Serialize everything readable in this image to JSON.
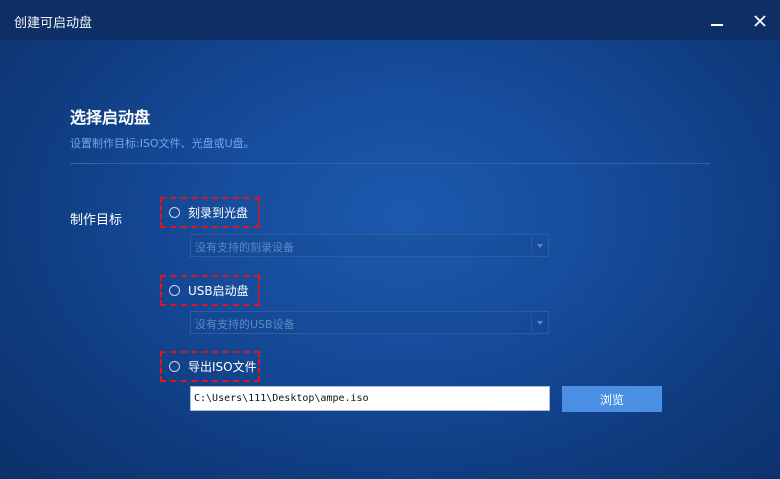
{
  "window": {
    "title": "创建可启动盘",
    "minimize_icon": "minimize-icon",
    "close_icon": "close-icon"
  },
  "section": {
    "title": "选择启动盘",
    "subtitle": "设置制作目标:ISO文件、光盘或U盘。"
  },
  "target_label": "制作目标",
  "options": [
    {
      "label": "刻录到光盘",
      "selected": false,
      "select_value": "没有支持的刻录设备"
    },
    {
      "label": "USB启动盘",
      "selected": false,
      "select_value": "没有支持的USB设备"
    },
    {
      "label": "导出ISO文件",
      "selected": false,
      "path_value": "C:\\Users\\111\\Desktop\\ampe.iso"
    }
  ],
  "browse_label": "浏览",
  "colors": {
    "accent": "#4a8fe3",
    "highlight_border": "#e0141c",
    "subtitle": "#6fa8ee"
  }
}
